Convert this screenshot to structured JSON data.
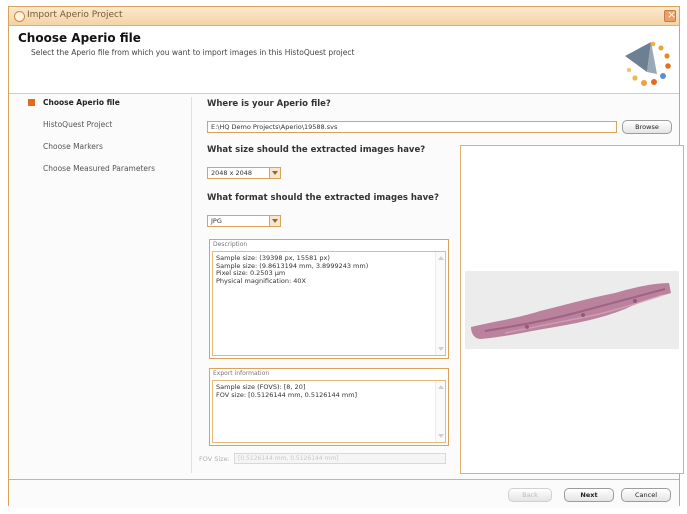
{
  "window": {
    "title": "Import Aperio Project"
  },
  "header": {
    "title": "Choose Aperio file",
    "subtitle": "Select the Aperio file from which you want to import images in this HistoQuest project"
  },
  "nav": {
    "items": [
      {
        "label": "Choose Aperio file",
        "active": true
      },
      {
        "label": "HistoQuest Project",
        "active": false
      },
      {
        "label": "Choose Markers",
        "active": false
      },
      {
        "label": "Choose Measured Parameters",
        "active": false
      }
    ]
  },
  "file": {
    "question": "Where is your Aperio file?",
    "path": "E:\\HQ Demo Projects\\Aperio\\19588.svs",
    "browse_label": "Browse"
  },
  "size": {
    "question": "What size should the extracted images have?",
    "selected": "2048 x 2048"
  },
  "format": {
    "question": "What format should the extracted images have?",
    "selected": "JPG"
  },
  "description": {
    "label": "Description",
    "text": "Sample size: (39398 px, 15581 px)\nSample size: (9.8613194 mm, 3.8999243 mm)\nPixel size: 0.2503 µm\nPhysical magnification: 40X"
  },
  "export": {
    "label": "Export information",
    "text": "Sample size (FOVS): [8, 20]\nFOV size: [0.5126144 mm, 0.5126144 mm]"
  },
  "fov": {
    "label": "FOV Size:",
    "value": "[0.5126144 mm, 0.5126144 mm]"
  },
  "buttons": {
    "back": "Back",
    "next": "Next",
    "cancel": "Cancel"
  },
  "colors": {
    "accent": "#e36b20",
    "border": "#d9a45a",
    "tissue": "#b1708f"
  }
}
